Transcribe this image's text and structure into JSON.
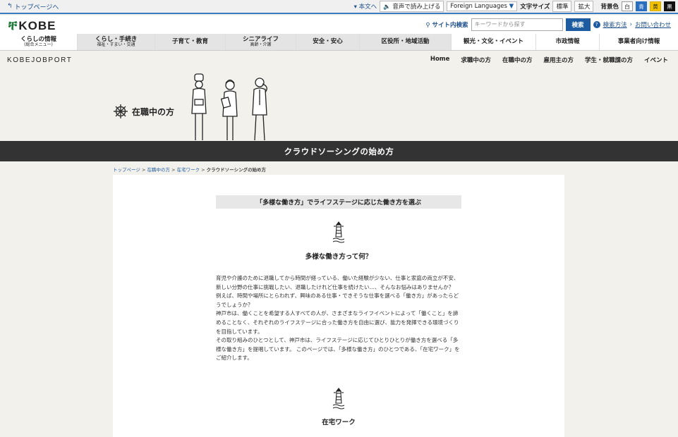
{
  "topbar": {
    "back": "トップページへ",
    "skip": "本文へ",
    "speech": "音声で読み上げる",
    "languages": "Foreign Languages",
    "textsize_label": "文字サイズ",
    "textsize_normal": "標準",
    "textsize_large": "拡大",
    "bgcolor_label": "背景色",
    "bg_white": "白",
    "bg_blue": "青",
    "bg_yellow": "黄",
    "bg_black": "黒"
  },
  "header": {
    "logo": "KOBE",
    "site_search_label": "サイト内検索",
    "search_placeholder": "キーワードから探す",
    "search_button": "検索",
    "search_help": "検索方法",
    "contact": "お問い合わせ"
  },
  "gnav": [
    {
      "label": "くらしの情報",
      "sub": "(総合メニュー)"
    },
    {
      "label": "くらし・手続き",
      "sub": "福祉・すまい・交通"
    },
    {
      "label": "子育て・教育",
      "sub": ""
    },
    {
      "label": "シニアライフ",
      "sub": "高齢・介護"
    },
    {
      "label": "安全・安心",
      "sub": ""
    },
    {
      "label": "区役所・地域活動",
      "sub": ""
    },
    {
      "label": "観光・文化・イベント",
      "sub": ""
    },
    {
      "label": "市政情報",
      "sub": ""
    },
    {
      "label": "事業者向け情報",
      "sub": ""
    }
  ],
  "jobport": {
    "logo": "KOBEJOBPORT",
    "links": [
      "Home",
      "求職中の方",
      "在職中の方",
      "雇用主の方",
      "学生・就職課の方",
      "イベント"
    ]
  },
  "hero": {
    "category": "在職中の方"
  },
  "page_title": "クラウドソーシングの始め方",
  "breadcrumb": {
    "items": [
      "トップページ",
      "在職中の方",
      "在宅ワーク"
    ],
    "current": "クラウドソーシングの始め方",
    "sep": " > "
  },
  "content": {
    "lead": "「多様な働き方」でライフステージに応じた働き方を選ぶ",
    "section1_title": "多様な働き方って何？",
    "paragraphs": [
      "育児や介護のために退職してから時間が経っている、働いた経験が少ない、仕事と家庭の両立が不安、新しい分野の仕事に挑戦したい、退職したけれど仕事を続けたい…、そんなお悩みはありませんか？",
      "例えば、時間や場所にとらわれず、興味のある仕事・できそうな仕事を選べる「働き方」があったらどうでしょうか？",
      "神戸市は、働くことを希望する人すべての人が、さまざまなライフイベントによって「働くこと」を諦めることなく、それぞれのライフステージに合った働き方を自由に選び、能力を発揮できる環境づくりを目指しています。",
      "その取り組みのひとつとして、神戸市は、ライフステージに応じてひとりひとりが働き方を選べる「多様な働き方」を提唱しています。 このページでは、「多様な働き方」のひとつである、「在宅ワーク」をご紹介します。"
    ],
    "section2_title": "在宅ワーク"
  },
  "colors": {
    "accent_blue": "#1d5ca0",
    "title_band": "#333333",
    "kobe_green": "#1f7a3a"
  }
}
